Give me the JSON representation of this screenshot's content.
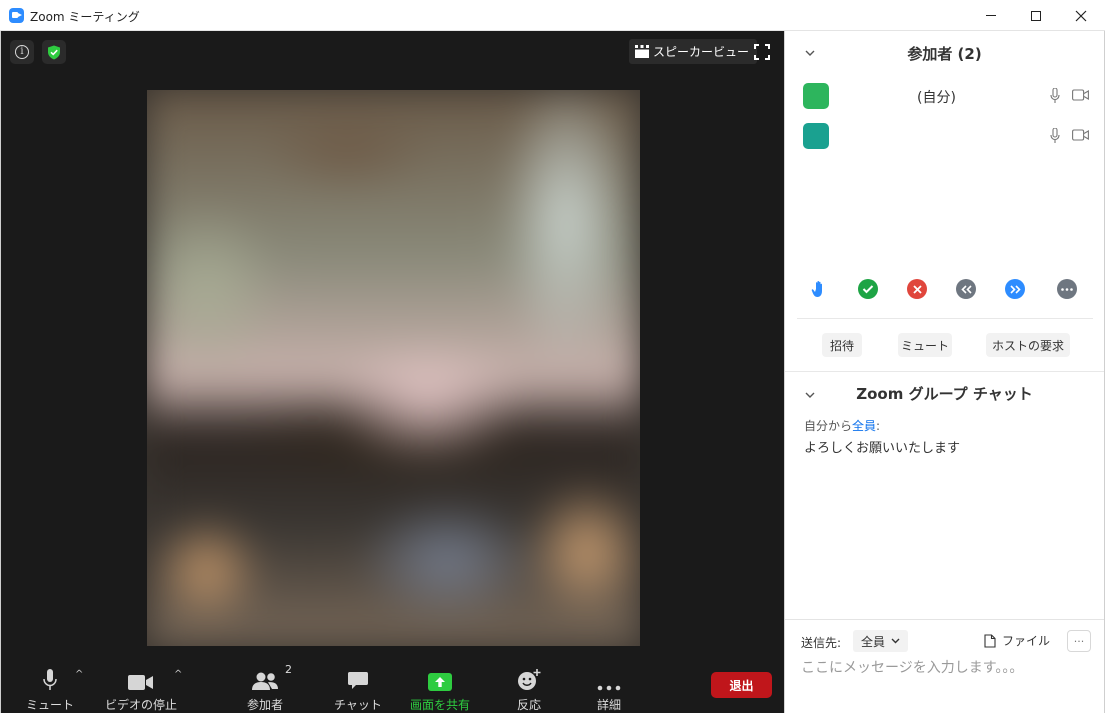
{
  "window": {
    "title": "Zoom ミーティング"
  },
  "video": {
    "speaker_view_label": "スピーカービュー"
  },
  "toolbar": {
    "mute": "ミュート",
    "stop_video": "ビデオの停止",
    "participants": "参加者",
    "participants_count": "2",
    "chat": "チャット",
    "share_screen": "画面を共有",
    "reactions": "反応",
    "more": "詳細",
    "leave": "退出"
  },
  "participants_panel": {
    "title": "参加者 (2)",
    "participants": [
      {
        "name": "(自分)",
        "avatar_color": "#2db55d"
      },
      {
        "name": "",
        "avatar_color": "#1aa190"
      }
    ],
    "reactions": [
      {
        "icon": "raise-hand-icon",
        "color": "#2d8cff"
      },
      {
        "icon": "yes-check-icon",
        "color": "#1ea445"
      },
      {
        "icon": "no-x-icon",
        "color": "#e0463c"
      },
      {
        "icon": "go-slower-icon",
        "color": "#6e7680"
      },
      {
        "icon": "go-faster-icon",
        "color": "#2d8cff"
      },
      {
        "icon": "more-icon",
        "color": "#6e7680"
      }
    ],
    "actions": {
      "invite": "招待",
      "mute_all": "ミュート",
      "claim_host": "ホストの要求"
    }
  },
  "chat_panel": {
    "title": "Zoom グループ チャット",
    "messages": [
      {
        "from": "自分から",
        "to": "全員",
        "separator": ":",
        "text": "よろしくお願いいたします"
      }
    ],
    "send_to_label": "送信先:",
    "send_to_value": "全員",
    "file_label": "ファイル",
    "more_label": "···",
    "input_placeholder": "ここにメッセージを入力します。。。"
  }
}
